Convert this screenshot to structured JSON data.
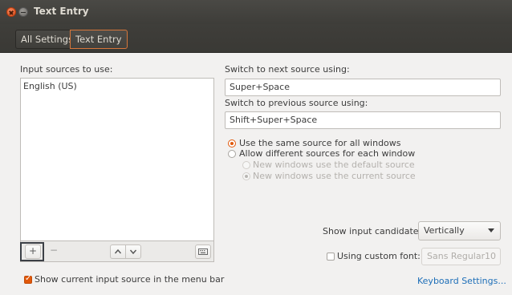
{
  "window": {
    "title": "Text Entry"
  },
  "breadcrumb": {
    "all_settings": "All Settings",
    "current": "Text Entry"
  },
  "input_sources": {
    "label": "Input sources to use:",
    "items": [
      "English (US)"
    ],
    "add_label": "+",
    "remove_label": "−",
    "up_icon": "chevron-up-icon",
    "down_icon": "chevron-down-icon",
    "keyboard_icon": "keyboard-icon"
  },
  "switch_next": {
    "label": "Switch to next source using:",
    "value": "Super+Space"
  },
  "switch_prev": {
    "label": "Switch to previous source using:",
    "value": "Shift+Super+Space"
  },
  "source_mode": {
    "same": "Use the same source for all windows",
    "different": "Allow different sources for each window",
    "new_default": "New windows use the default source",
    "new_current": "New windows use the current source",
    "selected": "same"
  },
  "candidates": {
    "label": "Show input candidates:",
    "value": "Vertically"
  },
  "custom_font": {
    "label": "Using custom font:",
    "checked": false,
    "font_name": "Sans Regular",
    "font_size": "10"
  },
  "menu_bar": {
    "label": "Show current input source in the menu bar",
    "checked": true
  },
  "keyboard_settings_link": "Keyboard Settings...",
  "colors": {
    "accent": "#e1580a",
    "link": "#1e6fb8",
    "titlebar": "#3e3d39"
  }
}
